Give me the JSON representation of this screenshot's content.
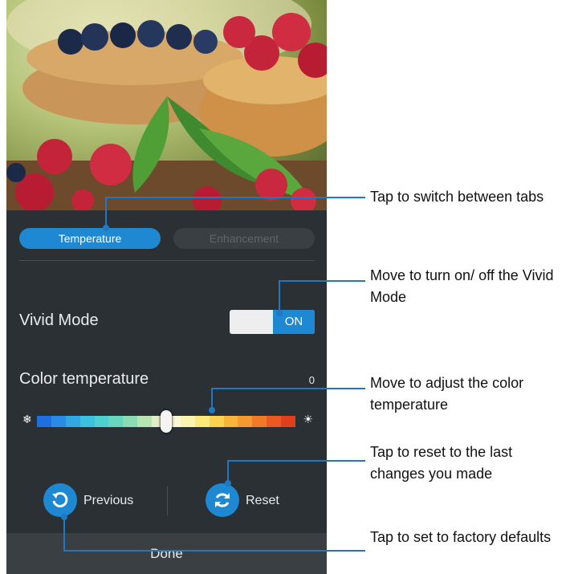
{
  "tabs": {
    "temperature": "Temperature",
    "enhancement": "Enhancement"
  },
  "vivid_mode": {
    "label": "Vivid Mode",
    "state": "ON"
  },
  "color_temperature": {
    "label": "Color temperature",
    "value": "0",
    "level": 0.5,
    "min_icon": "snowflake-icon",
    "max_icon": "sun-icon"
  },
  "buttons": {
    "previous": "Previous",
    "reset": "Reset",
    "done": "Done"
  },
  "colors": {
    "accent": "#1e88d2",
    "panel": "#2b3035",
    "bar": "#3a3f44"
  },
  "gradient": [
    "#1e6fe0",
    "#2a8be6",
    "#33a7e6",
    "#3cc2e0",
    "#4dd0cf",
    "#66d6bd",
    "#8bdcb4",
    "#b6e4b2",
    "#e6ecc8",
    "#f7f7d6",
    "#fbf4b0",
    "#fde87a",
    "#fcd24e",
    "#f9b53a",
    "#f59a2e",
    "#f07a25",
    "#ea5a20",
    "#e23e1c"
  ],
  "callouts": {
    "tabs": "Tap to switch between tabs",
    "vivid": "Move to turn on/ off the Vivid Mode",
    "temperature": "Move to adjust the color temperature",
    "reset": "Tap to reset to the last changes you made",
    "previous": "Tap to set to factory defaults"
  }
}
